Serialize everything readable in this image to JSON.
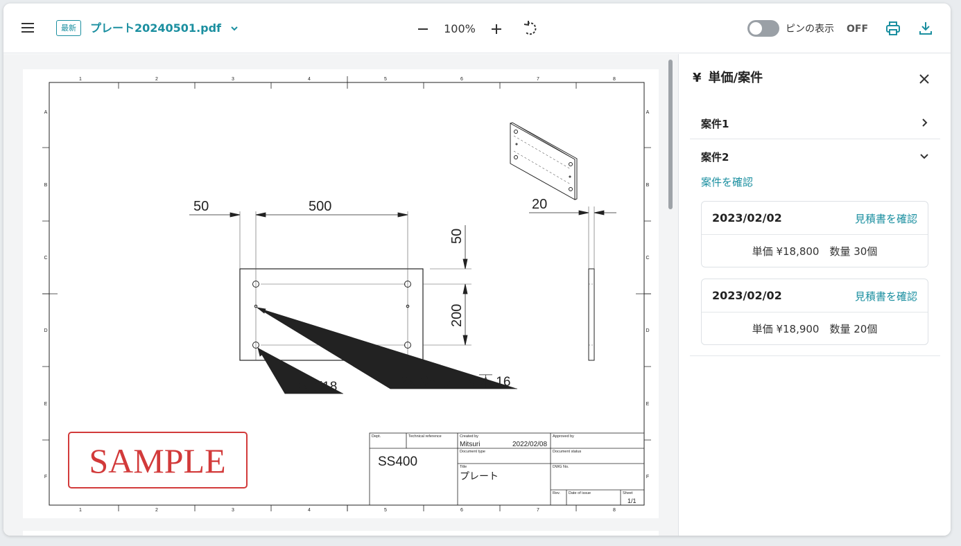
{
  "header": {
    "badge": "最新",
    "filename": "プレート20240501.pdf",
    "zoom": "100%",
    "pin_label": "ピンの表示",
    "pin_state": "OFF"
  },
  "drawing": {
    "col_labels": [
      "1",
      "2",
      "3",
      "4",
      "5",
      "6",
      "7",
      "8"
    ],
    "row_labels": [
      "A",
      "B",
      "C",
      "D",
      "E",
      "F"
    ],
    "dim_50_top": "50",
    "dim_500": "500",
    "dim_50_right": "50",
    "dim_200": "200",
    "dim_20": "20",
    "note_holes": "4x Ø18",
    "note_reamer": "2x Ø8 リーマ⏄ 16",
    "stamp": "SAMPLE",
    "title_block": {
      "dept_label": "Dept.",
      "techref_label": "Technical reference",
      "created_label": "Created by",
      "created_value": "Mitsuri",
      "created_date": "2022/02/08",
      "approved_label": "Approved by",
      "material": "SS400",
      "doctype_label": "Document type",
      "docstatus_label": "Document status",
      "title_label": "Title",
      "title_value": "プレート",
      "dwg_label": "DWG No.",
      "rev_label": "Rev.",
      "issue_label": "Date of issue",
      "sheet_label": "Sheet",
      "sheet_value": "1/1"
    }
  },
  "panel": {
    "icon": "¥",
    "title": "単価/案件",
    "cases": [
      {
        "label": "案件1",
        "state": "collapsed"
      },
      {
        "label": "案件2",
        "state": "expanded"
      }
    ],
    "confirm_link": "案件を確認",
    "quotes": [
      {
        "date": "2023/02/02",
        "link": "見積書を確認",
        "price": "単価 ¥18,800　数量 30個"
      },
      {
        "date": "2023/02/02",
        "link": "見積書を確認",
        "price": "単価 ¥18,900　数量 20個"
      }
    ]
  },
  "colors": {
    "accent": "#1b8fa0",
    "stamp": "#d23a3a"
  }
}
